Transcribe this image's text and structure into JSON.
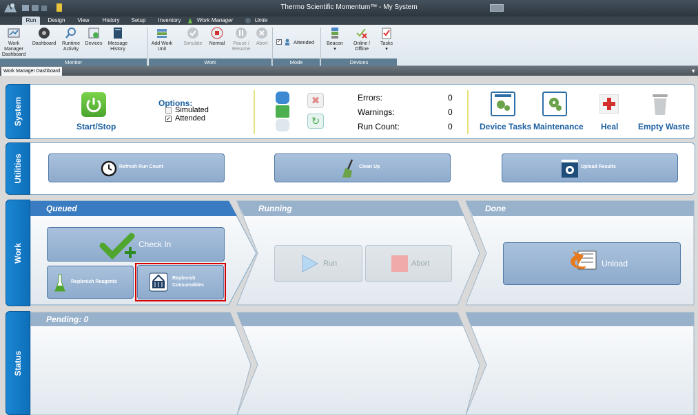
{
  "window": {
    "title": "Thermo Scientific Momentum™ - My System"
  },
  "ribbon_tabs": [
    "Run",
    "Design",
    "View",
    "History",
    "Setup",
    "Inventory",
    "Work Manager",
    "Unite"
  ],
  "ribbon": {
    "monitor": {
      "label": "Monitor",
      "buttons": [
        "Work Manager Dashboard",
        "Dashboard",
        "Runtime Activity",
        "Devices",
        "Message History"
      ]
    },
    "work": {
      "label": "Work",
      "buttons": [
        "Add Work Unit",
        "Simulate",
        "Normal",
        "Pause / Resume",
        "Abort"
      ]
    },
    "mode": {
      "label": "Mode",
      "attended": "Attended"
    },
    "devices": {
      "label": "Devices",
      "buttons": [
        "Beacon",
        "Online / Offline",
        "Tasks"
      ]
    }
  },
  "doc_tab": "Work Manager Dashboard",
  "system": {
    "side_label": "System",
    "start_stop": "Start/Stop",
    "options_title": "Options:",
    "simulated": "Simulated",
    "attended": "Attended",
    "errors_label": "Errors:",
    "errors": "0",
    "warnings_label": "Warnings:",
    "warnings": "0",
    "runcount_label": "Run Count:",
    "runcount": "0",
    "device_tasks": "Device Tasks",
    "maintenance": "Maintenance",
    "heal": "Heal",
    "empty_waste": "Empty Waste"
  },
  "utilities": {
    "side_label": "Utilities",
    "refresh": "Refresh Run Count",
    "cleanup": "Clean Up",
    "upload": "Upload Results"
  },
  "work": {
    "side_label": "Work",
    "queued": "Queued",
    "running": "Running",
    "done": "Done",
    "check_in": "Check In",
    "replenish_reagents": "Replenish Reagents",
    "replenish_consumables_1": "Replenish",
    "replenish_consumables_2": "Consumables",
    "run": "Run",
    "abort": "Abort",
    "unload": "Unload"
  },
  "status": {
    "side_label": "Status",
    "pending": "Pending: 0"
  },
  "colors": {
    "accent": "#1a86d3",
    "highlight": "#d40000",
    "header": "#2e6ea7"
  }
}
